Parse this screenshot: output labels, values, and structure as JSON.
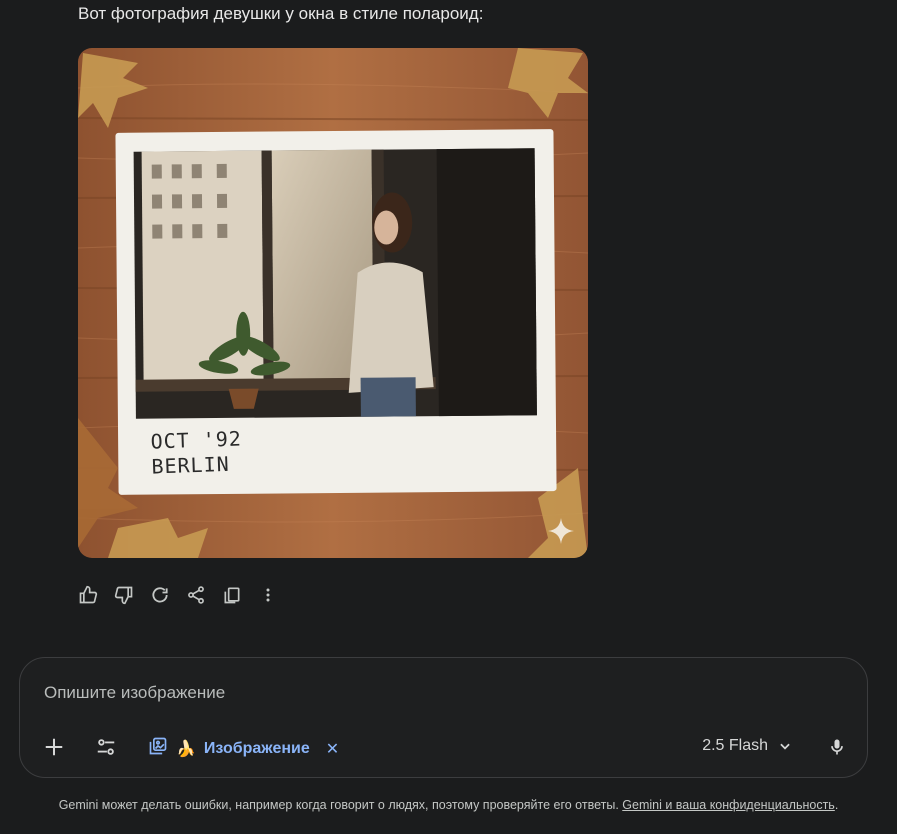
{
  "message": {
    "text": "Вот фотография девушки у окна в стиле полароид:"
  },
  "image": {
    "caption_line1": "OCT '92",
    "caption_line2": "BERLIN",
    "alt": "Polaroid photo of a woman by a window on a wooden background"
  },
  "actions": {
    "icons": [
      "thumbs-up-icon",
      "thumbs-down-icon",
      "regenerate-icon",
      "share-icon",
      "copy-icon",
      "more-icon"
    ]
  },
  "composer": {
    "placeholder": "Опишите изображение",
    "chip_emoji": "🍌",
    "chip_label": "Изображение",
    "chip_close": "✕",
    "model": "2.5 Flash"
  },
  "footer": {
    "text": "Gemini может делать ошибки, например когда говорит о людях, поэтому проверяйте его ответы. ",
    "link": "Gemini и ваша конфиденциальность",
    "end": "."
  },
  "colors": {
    "background": "#1b1c1d",
    "accent": "#8ab4f8",
    "wood": "#a8663a"
  }
}
